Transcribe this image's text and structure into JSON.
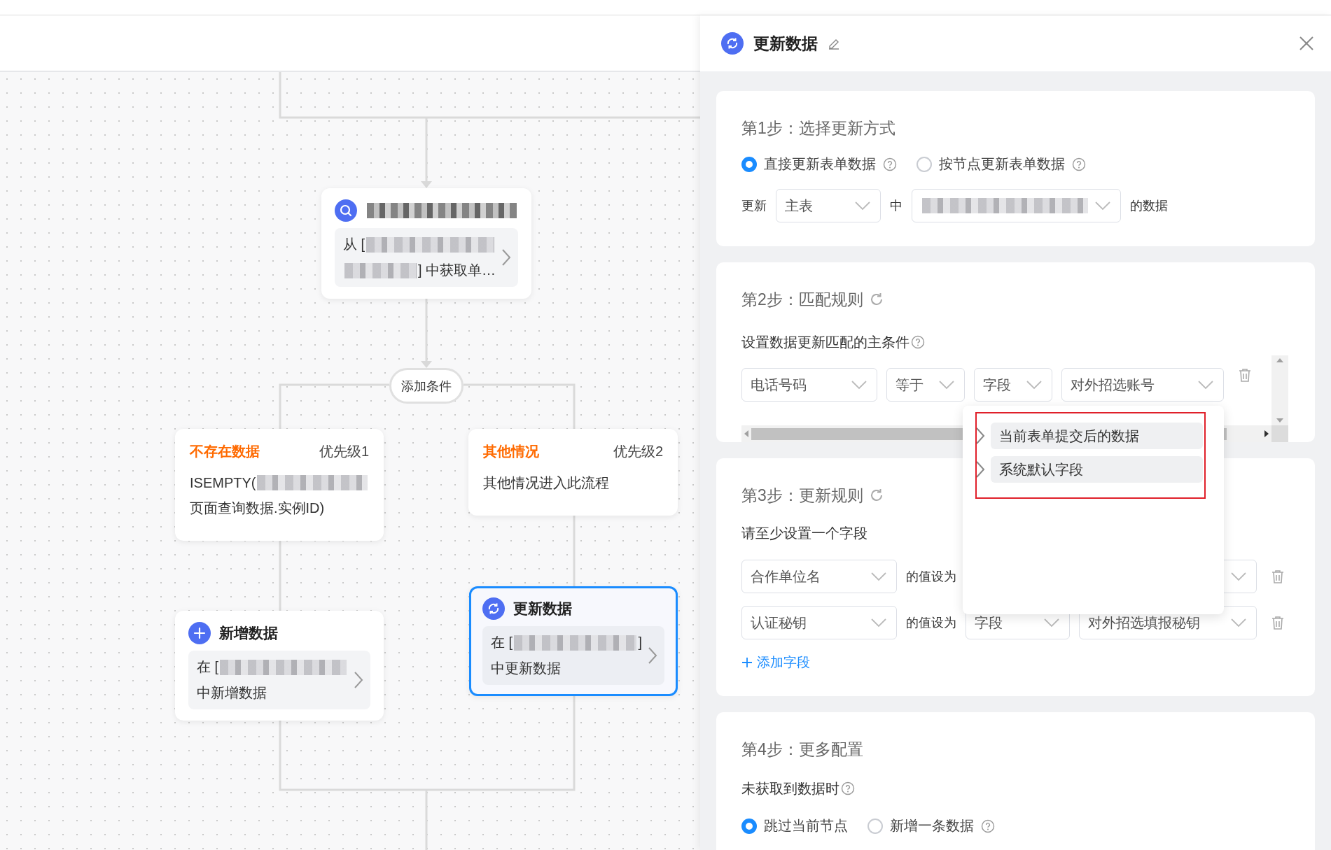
{
  "canvas": {
    "add_condition": "添加条件",
    "nodes": [
      {
        "kind": "query",
        "selected": false,
        "title": [
          {
            "kind": "redacted"
          }
        ],
        "lines": [
          [
            {
              "kind": "text",
              "text": "从 ["
            },
            {
              "kind": "redacted"
            }
          ],
          [
            {
              "kind": "redacted"
            },
            {
              "kind": "text",
              "text": "] 中获取单…"
            }
          ]
        ]
      },
      {
        "kind": "condition",
        "label": "不存在数据",
        "priority": "优先级1",
        "lines": [
          [
            {
              "kind": "text",
              "text": "ISEMPTY("
            },
            {
              "kind": "redacted"
            }
          ],
          [
            {
              "kind": "text",
              "text": "页面查询数据.实例ID)"
            }
          ]
        ]
      },
      {
        "kind": "condition",
        "label": "其他情况",
        "priority": "优先级2",
        "lines": [
          [
            {
              "kind": "text",
              "text": "其他情况进入此流程"
            }
          ]
        ]
      },
      {
        "kind": "add",
        "selected": false,
        "title": [
          {
            "kind": "text",
            "text": "新增数据"
          }
        ],
        "lines": [
          [
            {
              "kind": "text",
              "text": "在 ["
            },
            {
              "kind": "redacted"
            }
          ],
          [
            {
              "kind": "text",
              "text": "中新增数据"
            }
          ]
        ]
      },
      {
        "kind": "update",
        "selected": true,
        "title": [
          {
            "kind": "text",
            "text": "更新数据"
          }
        ],
        "lines": [
          [
            {
              "kind": "text",
              "text": "在 ["
            },
            {
              "kind": "redacted"
            },
            {
              "kind": "text",
              "text": "]"
            }
          ],
          [
            {
              "kind": "text",
              "text": "中更新数据"
            }
          ]
        ]
      }
    ]
  },
  "panel": {
    "title": "更新数据",
    "steps": [
      {
        "kind": "method",
        "title": "第1步：选择更新方式",
        "options": [
          {
            "label": "直接更新表单数据",
            "help": true,
            "selected": true
          },
          {
            "label": "按节点更新表单数据",
            "help": true,
            "selected": false
          }
        ],
        "target": {
          "prefix": "更新",
          "table": "主表",
          "middle": "中",
          "form": [
            {
              "kind": "redacted"
            }
          ],
          "suffix": "的数据"
        }
      },
      {
        "kind": "match",
        "title": "第2步：匹配规则",
        "refresh": true,
        "subtitle": "设置数据更新匹配的主条件",
        "help": true,
        "condition": [
          "电话号码",
          "等于",
          "字段",
          "对外招选账号"
        ]
      },
      {
        "kind": "rules",
        "title": "第3步：更新规则",
        "refresh": true,
        "subtitle": "请至少设置一个字段",
        "rows": [
          {
            "field": "合作单位名",
            "relation": "的值设为"
          },
          {
            "field": "认证秘钥",
            "relation": "的值设为",
            "type": "字段",
            "value": "对外招选填报秘钥"
          }
        ],
        "add": "添加字段"
      },
      {
        "kind": "more",
        "title": "第4步：更多配置",
        "subtitle": "未获取到数据时",
        "help": true,
        "options": [
          {
            "label": "跳过当前节点",
            "help": false,
            "selected": true
          },
          {
            "label": "新增一条数据",
            "help": true,
            "selected": false
          }
        ]
      }
    ],
    "popup": {
      "highlighted": true,
      "items": [
        {
          "label": "当前表单提交后的数据"
        },
        {
          "label": "系统默认字段"
        }
      ]
    }
  }
}
